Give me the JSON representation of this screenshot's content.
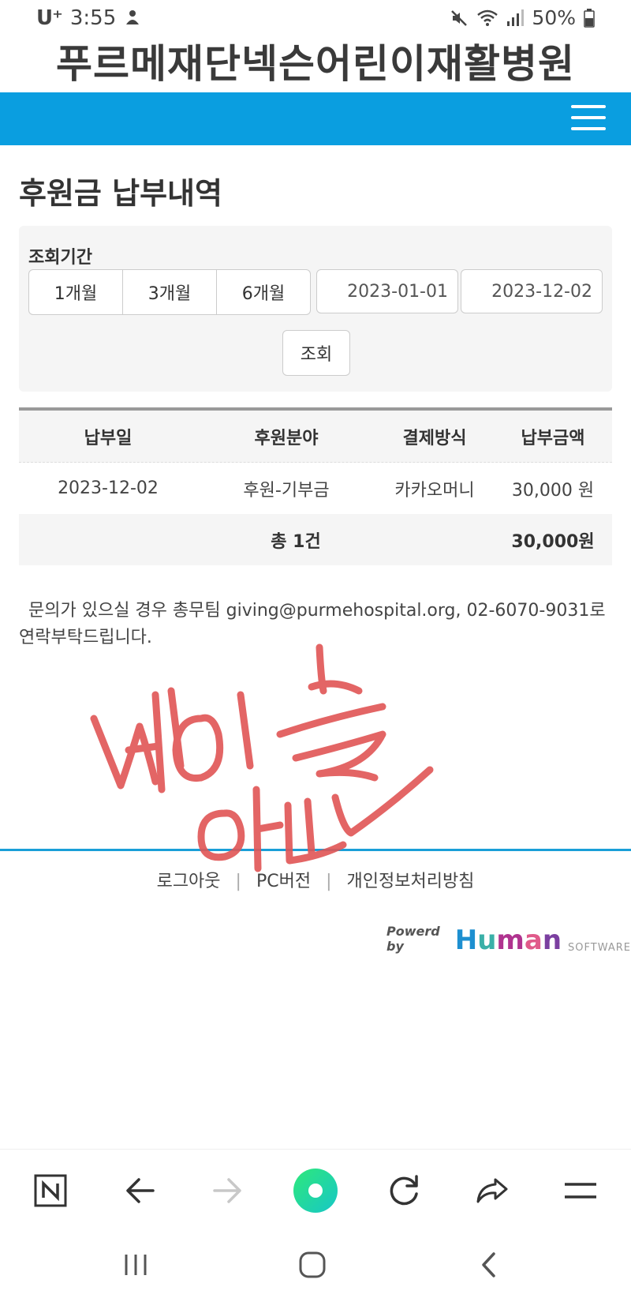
{
  "status_bar": {
    "carrier": "U⁺",
    "time": "3:55",
    "battery": "50%",
    "icons": [
      "mute-icon",
      "wifi-icon",
      "signal-icon",
      "battery-icon"
    ]
  },
  "header": {
    "site_title": "푸르메재단넥슨어린이재활병원",
    "nav_color": "#0a9ee0"
  },
  "page": {
    "title": "후원금 납부내역"
  },
  "search": {
    "period_label": "조회기간",
    "period_options": [
      "1개월",
      "3개월",
      "6개월"
    ],
    "start_date": "2023-01-01",
    "end_date": "2023-12-02",
    "search_label": "조회"
  },
  "table": {
    "headers": [
      "납부일",
      "후원분야",
      "결제방식",
      "납부금액"
    ],
    "rows": [
      [
        "2023-12-02",
        "후원-기부금",
        "카카오머니",
        "30,000 원"
      ]
    ],
    "footer_count": "총 1건",
    "footer_total": "30,000원"
  },
  "notice": "문의가 있으실 경우 총무팀 giving@purmehospital.org, 02-6070-9031로 연락부탁드립니다.",
  "signature": {
    "color": "#e05555"
  },
  "footer": {
    "links": [
      "로그아웃",
      "PC버전",
      "개인정보처리방침"
    ],
    "separator": "|",
    "powered_by": "Powerd by",
    "brand": "Human",
    "brand_suffix": "SOFTWARE"
  },
  "browser_toolbar": {
    "icons": [
      "naver-icon",
      "back-arrow-icon",
      "forward-arrow-icon",
      "home-circle-icon",
      "refresh-icon",
      "share-icon",
      "menu-lines-icon"
    ]
  },
  "system_nav": {
    "icons": [
      "recent-apps-icon",
      "home-icon",
      "back-icon"
    ]
  }
}
